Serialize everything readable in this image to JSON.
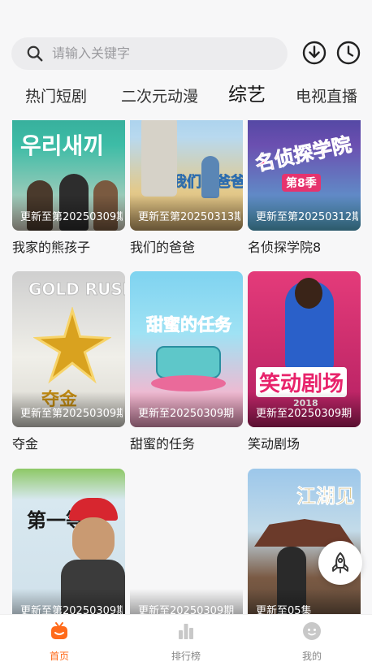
{
  "search": {
    "placeholder": "请输入关键字"
  },
  "header_icons": [
    "download-icon",
    "history-clock-icon"
  ],
  "tabs": [
    {
      "label": "热门短剧",
      "active": false
    },
    {
      "label": "二次元动漫",
      "active": false
    },
    {
      "label": "综艺",
      "active": true
    },
    {
      "label": "电视直播",
      "active": false
    }
  ],
  "cards": [
    {
      "title": "我家的熊孩子",
      "update": "更新至第20250309期",
      "poster_text": "우리새끼"
    },
    {
      "title": "我们的爸爸",
      "update": "更新至第20250313期",
      "poster_text": "我们的爸爸"
    },
    {
      "title": "名侦探学院8",
      "update": "更新至第20250312期",
      "poster_text": "名侦探学院",
      "poster_sub": "第8季"
    },
    {
      "title": "夺金",
      "update": "更新至第20250309期",
      "poster_text": "夺金",
      "poster_sub": "GOLD RUSH"
    },
    {
      "title": "甜蜜的任务",
      "update": "更新至20250309期",
      "poster_text": "甜蜜的任务"
    },
    {
      "title": "笑动剧场",
      "update": "更新至20250309期",
      "poster_text": "笑动剧场",
      "poster_sub": "2018"
    },
    {
      "title": "",
      "update": "更新至第20250309期",
      "poster_text": "第一等"
    },
    {
      "title": "",
      "update": "更新至20250309期",
      "poster_text": ""
    },
    {
      "title": "",
      "update": "更新至05集",
      "poster_text": "江湖见"
    }
  ],
  "bottom_nav": [
    {
      "label": "首页",
      "icon": "home-tv-icon",
      "active": true
    },
    {
      "label": "排行榜",
      "icon": "bar-chart-icon",
      "active": false
    },
    {
      "label": "我的",
      "icon": "profile-face-icon",
      "active": false
    }
  ],
  "fab": {
    "icon": "rocket-icon"
  },
  "colors": {
    "accent": "#ff6a1a",
    "background": "#f7f7f8"
  }
}
